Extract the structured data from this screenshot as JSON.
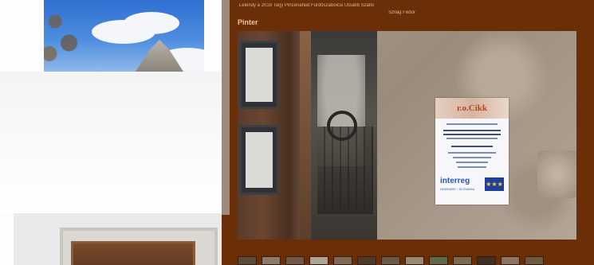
{
  "lightbox": {
    "header_text": "Lelendy a 2018 Tarjy Pincénahlat Fürdőszabolcsi Utsabb Szálló",
    "header_sub": "Szilág Fedor",
    "title": "Pinter"
  },
  "poster": {
    "logo": "r.o.Cikk",
    "brand": "interreg",
    "brand_sub": "HUNGARY · SLOVAKIA",
    "eu_stars": "★★★"
  },
  "thumbnails": [
    {
      "color": "#5a4a3a"
    },
    {
      "color": "#8a7b6b"
    },
    {
      "color": "#6e5a46"
    },
    {
      "color": "#b0a595"
    },
    {
      "color": "#7d6a55"
    },
    {
      "color": "#4d3a2a"
    },
    {
      "color": "#6a5a48"
    },
    {
      "color": "#9a8a74"
    },
    {
      "color": "#5e6a4a"
    },
    {
      "color": "#7a6a52"
    },
    {
      "color": "#3e2f23"
    },
    {
      "color": "#8a7560"
    },
    {
      "color": "#6d5a43"
    }
  ],
  "colors": {
    "lightbox_bg": "#6a2e08",
    "title_color": "#e8c79a"
  }
}
